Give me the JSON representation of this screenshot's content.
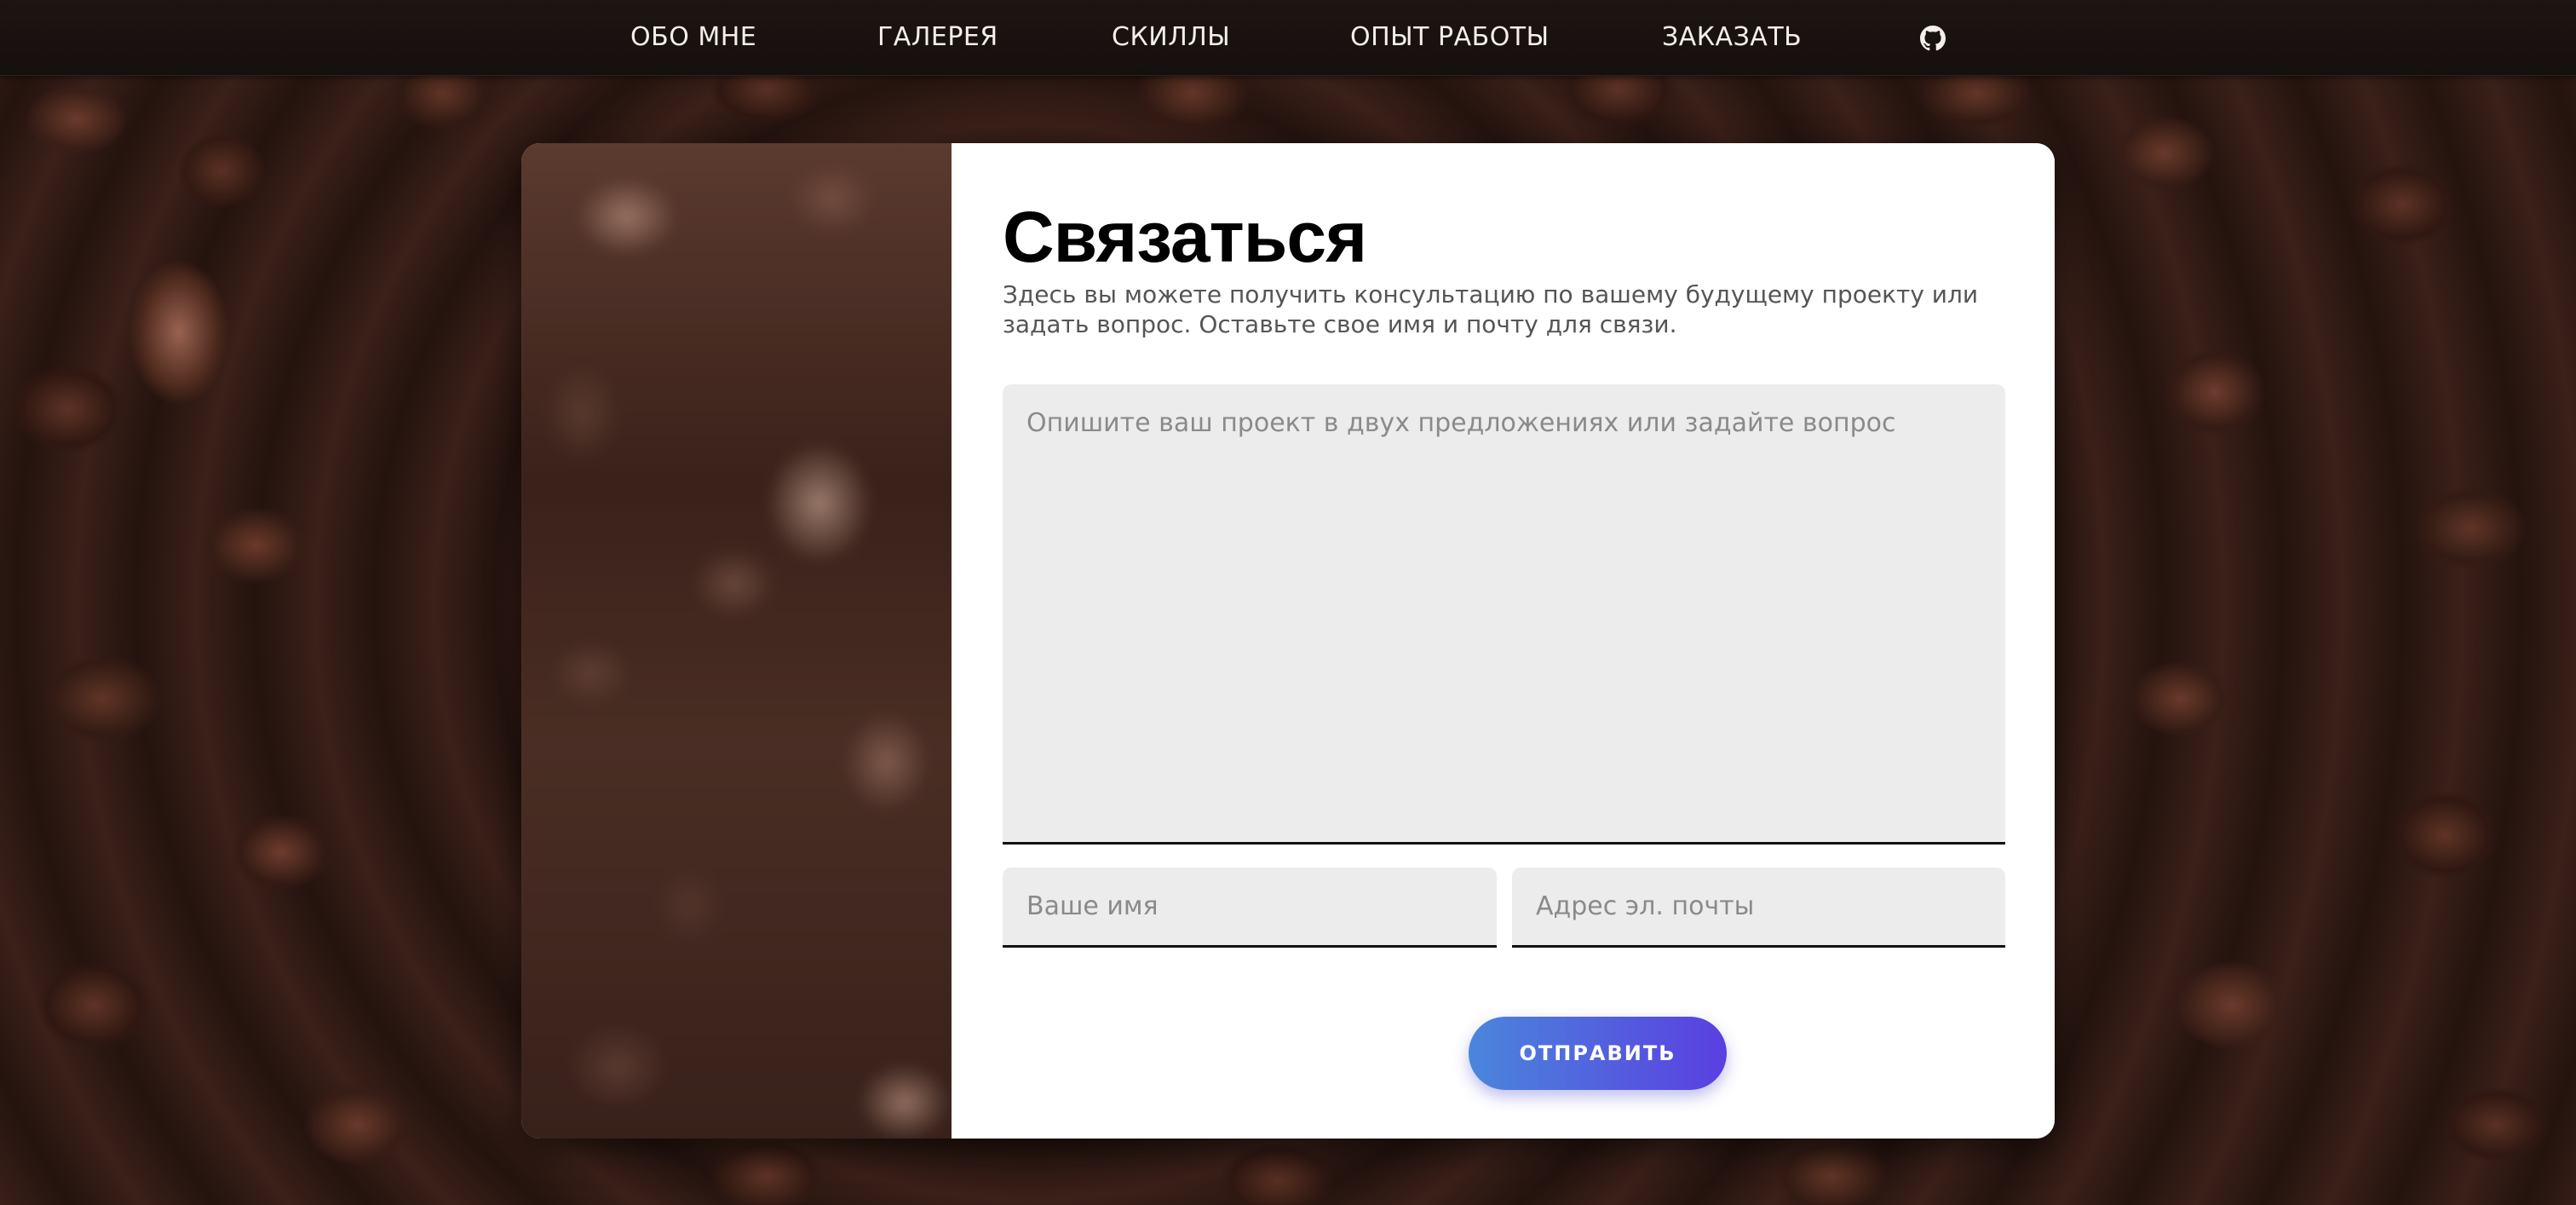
{
  "nav": {
    "items": [
      {
        "label": "ОБО МНЕ"
      },
      {
        "label": "ГАЛЕРЕЯ"
      },
      {
        "label": "СКИЛЛЫ"
      },
      {
        "label": "ОПЫТ РАБОТЫ"
      },
      {
        "label": "ЗАКАЗАТЬ"
      }
    ],
    "github_icon": "github-icon"
  },
  "contact": {
    "title": "Связаться",
    "subtitle": "Здесь вы можете получить консультацию по вашему будущему проекту или задать вопрос. Оставьте свое имя и почту для связи.",
    "message_placeholder": "Опишите ваш проект в двух предложениях или задайте вопрос",
    "message_value": "",
    "name_placeholder": "Ваше имя",
    "name_value": "",
    "email_placeholder": "Адрес эл. почты",
    "email_value": "",
    "submit_label": "ОТПРАВИТЬ"
  },
  "colors": {
    "nav_background": "#1a1210",
    "nav_text": "#f4efe9",
    "card_background": "#ffffff",
    "field_background": "#ececec",
    "field_underline": "#111111",
    "button_gradient_start": "#4a86dc",
    "button_gradient_end": "#5a3fe0"
  }
}
